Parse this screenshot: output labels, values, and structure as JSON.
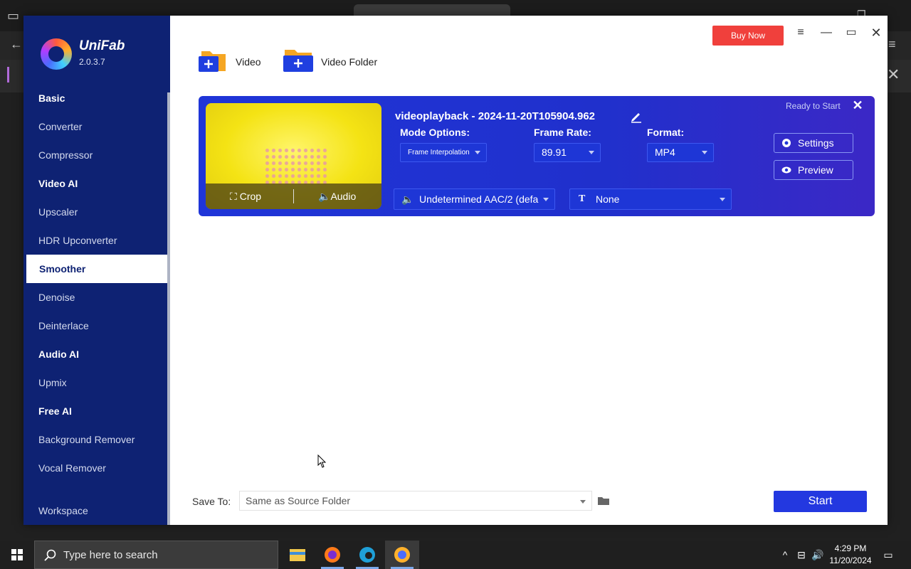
{
  "app": {
    "name": "UniFab",
    "version": "2.0.3.7",
    "buy_now": "Buy Now"
  },
  "sidebar": {
    "items": [
      {
        "label": "Basic",
        "type": "header"
      },
      {
        "label": "Converter",
        "type": "item"
      },
      {
        "label": "Compressor",
        "type": "item"
      },
      {
        "label": "Video AI",
        "type": "header"
      },
      {
        "label": "Upscaler",
        "type": "item"
      },
      {
        "label": "HDR Upconverter",
        "type": "item"
      },
      {
        "label": "Smoother",
        "type": "active"
      },
      {
        "label": "Denoise",
        "type": "item"
      },
      {
        "label": "Deinterlace",
        "type": "item"
      },
      {
        "label": "Audio AI",
        "type": "header"
      },
      {
        "label": "Upmix",
        "type": "item"
      },
      {
        "label": "Free AI",
        "type": "header"
      },
      {
        "label": "Background Remover",
        "type": "item"
      },
      {
        "label": "Vocal Remover",
        "type": "item"
      }
    ],
    "workspace": "Workspace"
  },
  "toolbar": {
    "add_video": "Video",
    "add_folder": "Video Folder"
  },
  "task": {
    "title": "videoplayback - 2024-11-20T105904.962",
    "status": "Ready to Start",
    "crop_label": "Crop",
    "audio_label": "Audio",
    "mode_label": "Mode Options:",
    "mode_value": "Frame Interpolation",
    "frame_rate_label": "Frame Rate:",
    "frame_rate_value": "89.91",
    "format_label": "Format:",
    "format_value": "MP4",
    "audio_track": "Undetermined AAC/2 (defa",
    "subtitle": "None",
    "settings": "Settings",
    "preview": "Preview"
  },
  "footer": {
    "save_to_label": "Save To:",
    "save_to_value": "Same as Source Folder",
    "start": "Start"
  },
  "taskbar": {
    "search_placeholder": "Type here to search",
    "time": "4:29 PM",
    "date": "11/20/2024"
  },
  "colors": {
    "sidebar": "#0e2273",
    "card": "#1f35d8",
    "buy_now": "#f0403c",
    "start": "#2338e0"
  }
}
